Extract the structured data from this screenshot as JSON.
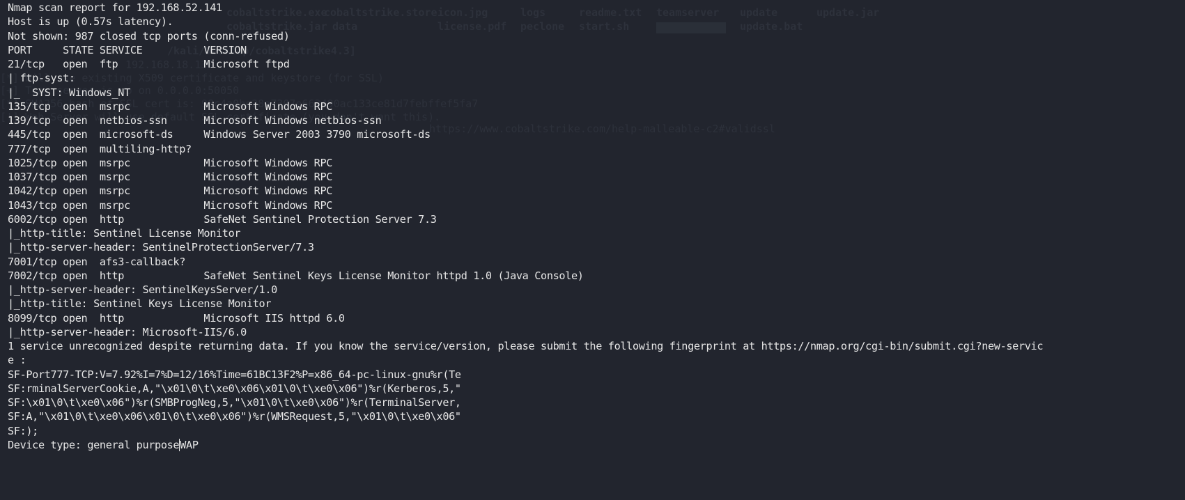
{
  "terminal": {
    "background_color": "#22252e",
    "text_color": "#e6e6e6",
    "lines": [
      "Nmap scan report for 192.168.52.141",
      "Host is up (0.57s latency).",
      "Not shown: 987 closed tcp ports (conn-refused)",
      "PORT     STATE SERVICE          VERSION",
      "21/tcp   open  ftp              Microsoft ftpd",
      "| ftp-syst:",
      "|_  SYST: Windows_NT",
      "135/tcp  open  msrpc            Microsoft Windows RPC",
      "139/tcp  open  netbios-ssn      Microsoft Windows netbios-ssn",
      "445/tcp  open  microsoft-ds     Windows Server 2003 3790 microsoft-ds",
      "777/tcp  open  multiling-http?",
      "1025/tcp open  msrpc            Microsoft Windows RPC",
      "1037/tcp open  msrpc            Microsoft Windows RPC",
      "1042/tcp open  msrpc            Microsoft Windows RPC",
      "1043/tcp open  msrpc            Microsoft Windows RPC",
      "6002/tcp open  http             SafeNet Sentinel Protection Server 7.3",
      "|_http-title: Sentinel License Monitor",
      "|_http-server-header: SentinelProtectionServer/7.3",
      "7001/tcp open  afs3-callback?",
      "7002/tcp open  http             SafeNet Sentinel Keys License Monitor httpd 1.0 (Java Console)",
      "|_http-server-header: SentinelKeysServer/1.0",
      "|_http-title: Sentinel Keys License Monitor",
      "8099/tcp open  http             Microsoft IIS httpd 6.0",
      "|_http-server-header: Microsoft-IIS/6.0",
      "1 service unrecognized despite returning data. If you know the service/version, please submit the following fingerprint at https://nmap.org/cgi-bin/submit.cgi?new-servic",
      "e :",
      "SF-Port777-TCP:V=7.92%I=7%D=12/16%Time=61BC13F2%P=x86_64-pc-linux-gnu%r(Te",
      "SF:rminalServerCookie,A,\"\\x01\\0\\t\\xe0\\x06\\x01\\0\\t\\xe0\\x06\")%r(Kerberos,5,\"",
      "SF:\\x01\\0\\t\\xe0\\x06\")%r(SMBProgNeg,5,\"\\x01\\0\\t\\xe0\\x06\")%r(TerminalServer,",
      "SF:A,\"\\x01\\0\\t\\xe0\\x06\\x01\\0\\t\\xe0\\x06\")%r(WMSRequest,5,\"\\x01\\0\\t\\xe0\\x06\"",
      "SF:);"
    ],
    "last_line_before_cursor": "Device type: general purpose",
    "last_line_after_cursor": "WAP"
  },
  "background_window": {
    "files_row1": [
      "cobaltstrike.exe",
      "cobaltstrike.store",
      "icon.jpg",
      "logs",
      "readme.txt",
      "teamserver",
      "update",
      "update.jar"
    ],
    "files_row2": [
      "cobaltstrike.jar",
      "data",
      "license.pdf",
      "peclone",
      "start.sh",
      "update.bat"
    ],
    "prompt": "/kali/Desktop/cobaltstrike4.3]",
    "output": [
      "192.168.18.130",
      "[*] Will use existing X509 certificate and keystore (for SSL)",
      "[+] Team server is up on 0.0.0.0:50050",
      "[*] SHA256 hash of SSL cert is: 98c4a0be28a7307e663490ac133ce81d7febffef5fa7",
      "[!] Web Server will use default SSL certificate (you don't want this).",
      "    https://www.cobaltstrike.com/help-malleable-c2#validssl"
    ]
  }
}
